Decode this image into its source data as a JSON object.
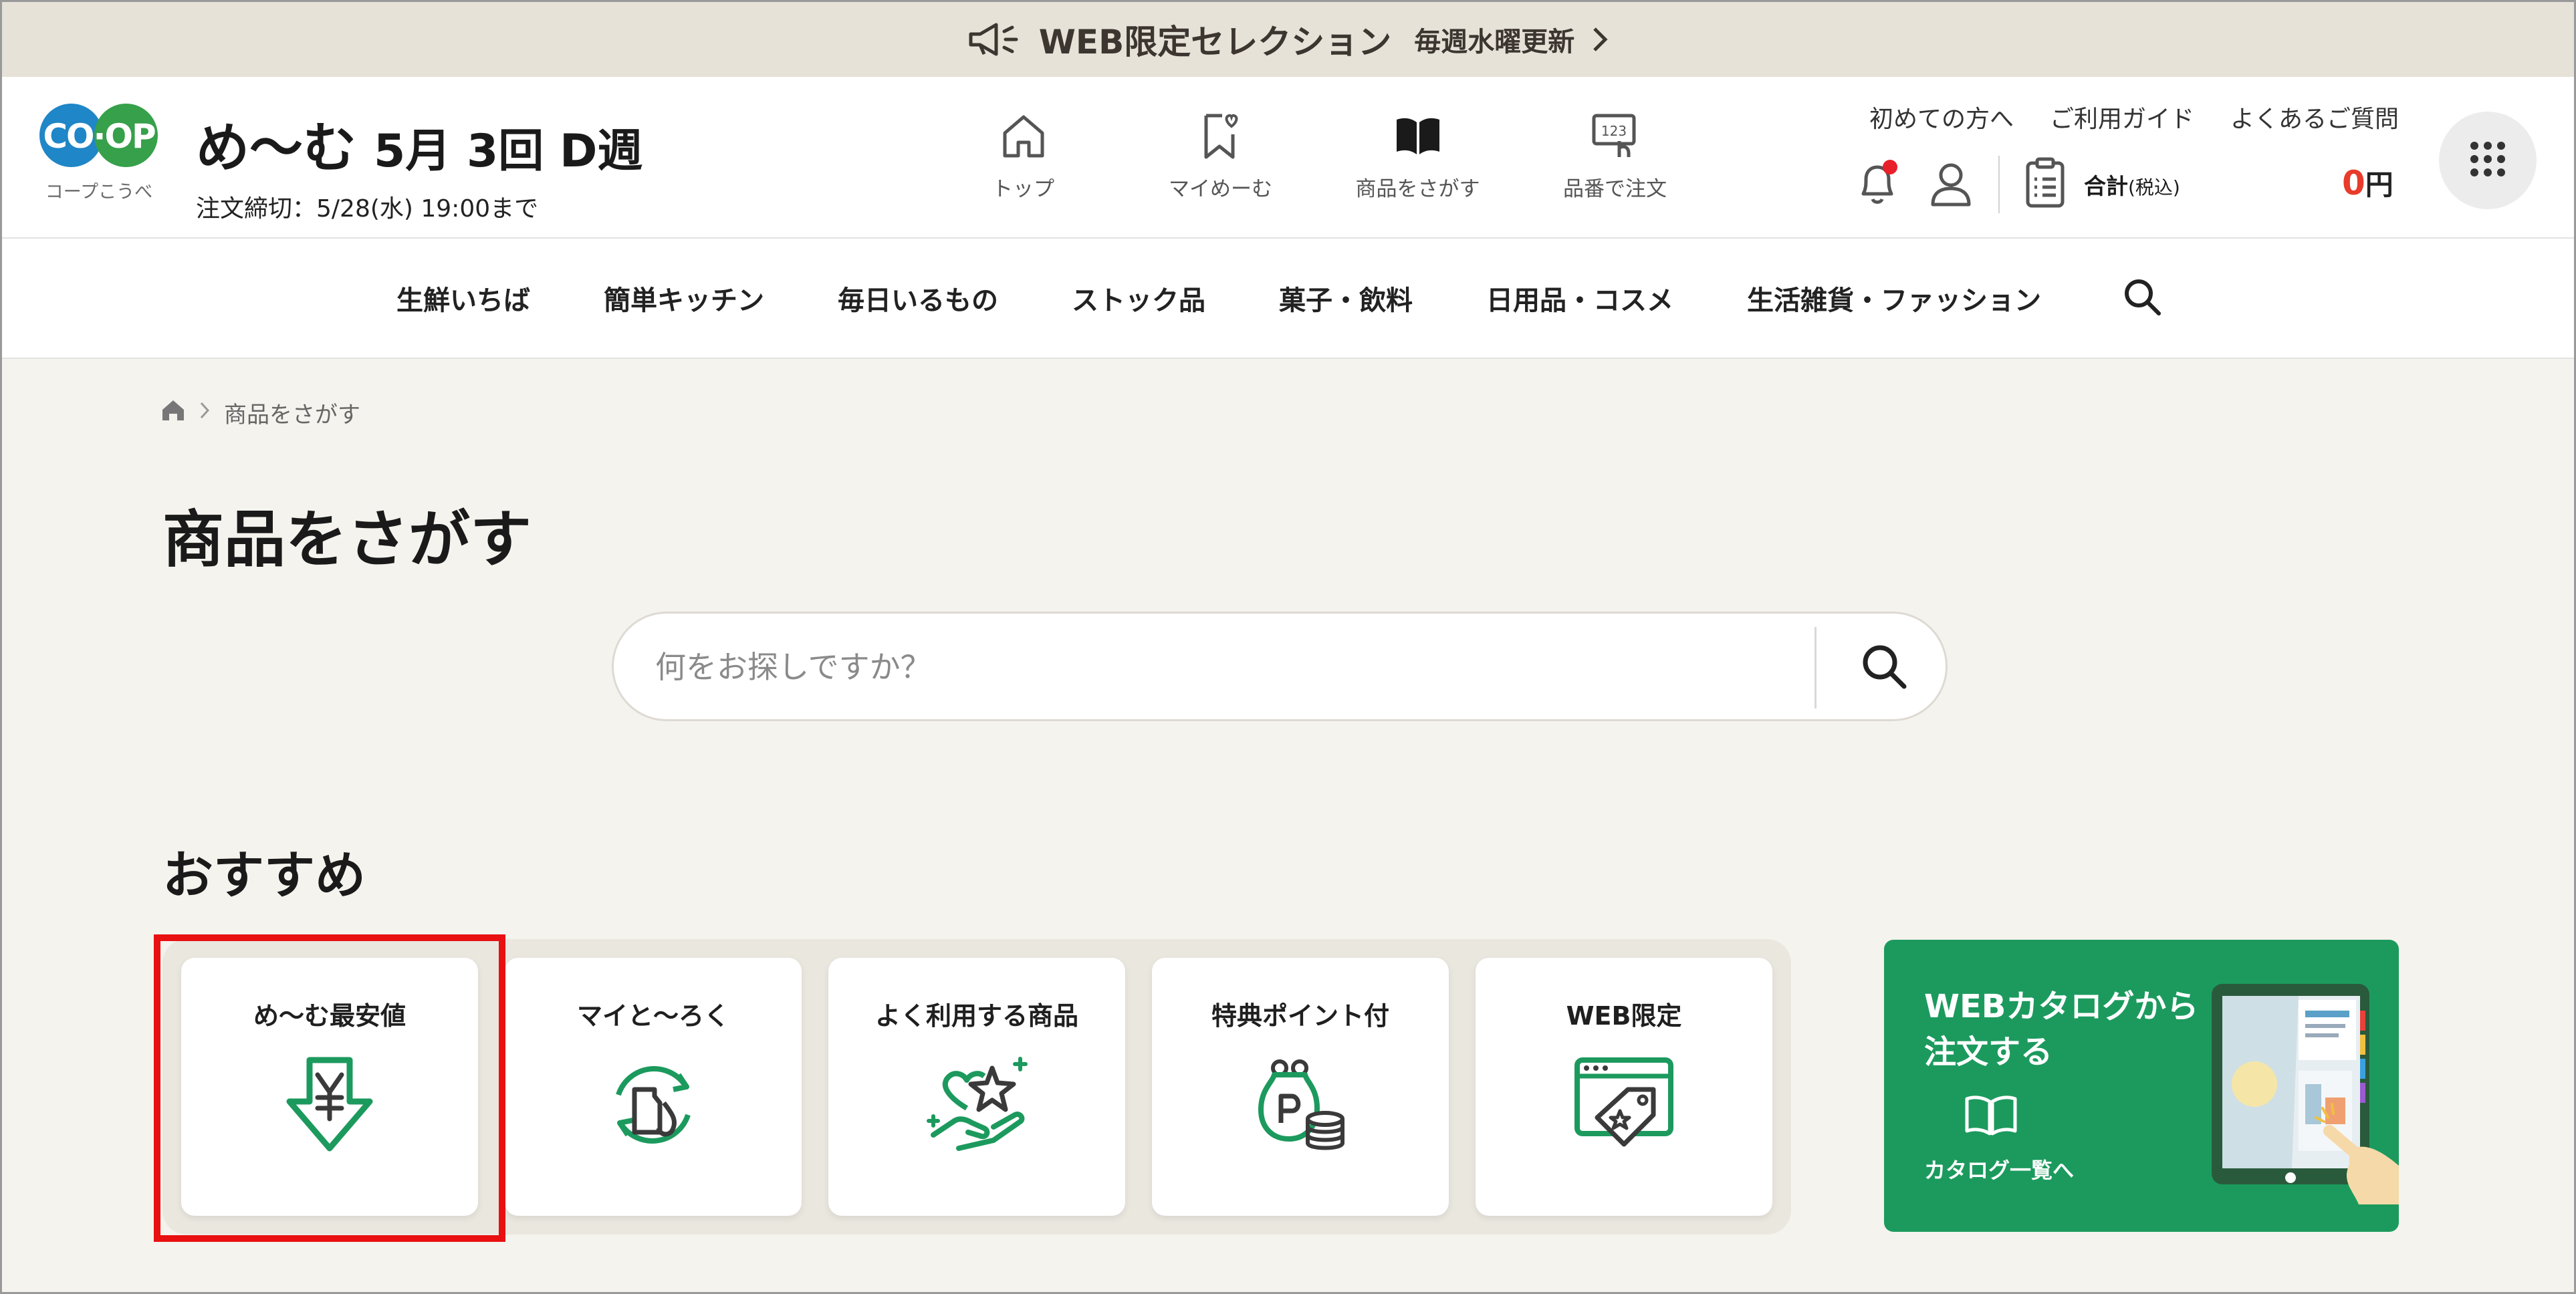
{
  "banner": {
    "text": "WEB限定セレクション",
    "sub": "毎週水曜更新"
  },
  "logo": {
    "mark": "CO·OP",
    "sub": "コープこうべ"
  },
  "header": {
    "brand": "め〜む",
    "period": "5月 3回 D週",
    "deadline": "注文締切：5/28(水) 19:00まで"
  },
  "nav_icons": [
    {
      "label": "トップ"
    },
    {
      "label": "マイめーむ"
    },
    {
      "label": "商品をさがす"
    },
    {
      "label": "品番で注文"
    }
  ],
  "top_links": [
    "初めての方へ",
    "ご利用ガイド",
    "よくあるご質問"
  ],
  "cart": {
    "total_label": "合計",
    "tax_label": "(税込)",
    "amount": "0",
    "currency": "円"
  },
  "categories": [
    "生鮮いちば",
    "簡単キッチン",
    "毎日いるもの",
    "ストック品",
    "菓子・飲料",
    "日用品・コスメ",
    "生活雑貨・ファッション"
  ],
  "breadcrumb": {
    "current": "商品をさがす"
  },
  "page_title": "商品をさがす",
  "search": {
    "placeholder": "何をお探しですか？"
  },
  "section_title": "おすすめ",
  "cards": [
    {
      "label": "め〜む最安値",
      "icon": "yen-down-arrow-icon"
    },
    {
      "label": "マイと〜ろく",
      "icon": "recycle-bottle-icon"
    },
    {
      "label": "よく利用する商品",
      "icon": "heart-star-hand-icon"
    },
    {
      "label": "特典ポイント付",
      "icon": "points-purse-icon"
    },
    {
      "label": "WEB限定",
      "icon": "web-tag-icon"
    }
  ],
  "promo": {
    "title_line1": "WEBカタログから",
    "title_line2": "注文する",
    "link": "カタログ一覧へ"
  },
  "colors": {
    "accent_green": "#1c9a5e",
    "brand_blue": "#1f86c7",
    "brand_green": "#36a04a",
    "alert_red": "#e83b2b",
    "highlight_red": "#e81010"
  }
}
